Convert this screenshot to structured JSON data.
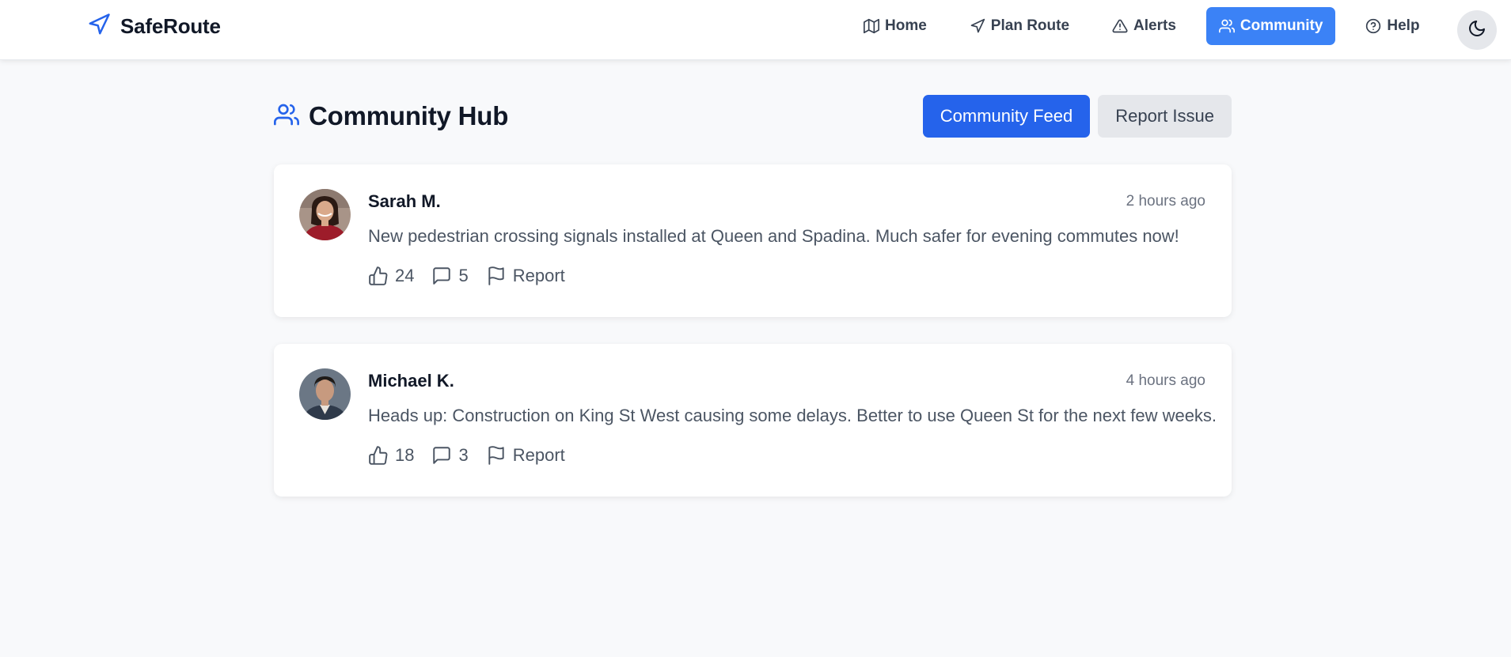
{
  "app": {
    "name": "SafeRoute",
    "logo_icon": "navigation-icon",
    "accent_color": "#2563eb"
  },
  "nav": {
    "items": [
      {
        "label": "Home",
        "icon": "map-icon",
        "active": false
      },
      {
        "label": "Plan Route",
        "icon": "navigation-icon",
        "active": false
      },
      {
        "label": "Alerts",
        "icon": "alert-triangle-icon",
        "active": false
      },
      {
        "label": "Community",
        "icon": "users-icon",
        "active": true
      },
      {
        "label": "Help",
        "icon": "help-circle-icon",
        "active": false
      }
    ],
    "theme_toggle_icon": "moon-icon"
  },
  "hub": {
    "title": "Community Hub",
    "title_icon": "users-icon",
    "tabs": [
      {
        "label": "Community Feed",
        "active": true
      },
      {
        "label": "Report Issue",
        "active": false
      }
    ]
  },
  "posts": [
    {
      "author": "Sarah M.",
      "time": "2 hours ago",
      "text": "New pedestrian crossing signals installed at Queen and Spadina. Much safer for evening commutes now!",
      "likes": "24",
      "comments": "5",
      "report_label": "Report"
    },
    {
      "author": "Michael K.",
      "time": "4 hours ago",
      "text": "Heads up: Construction on King St West causing some delays. Better to use Queen St for the next few weeks.",
      "likes": "18",
      "comments": "3",
      "report_label": "Report"
    }
  ]
}
